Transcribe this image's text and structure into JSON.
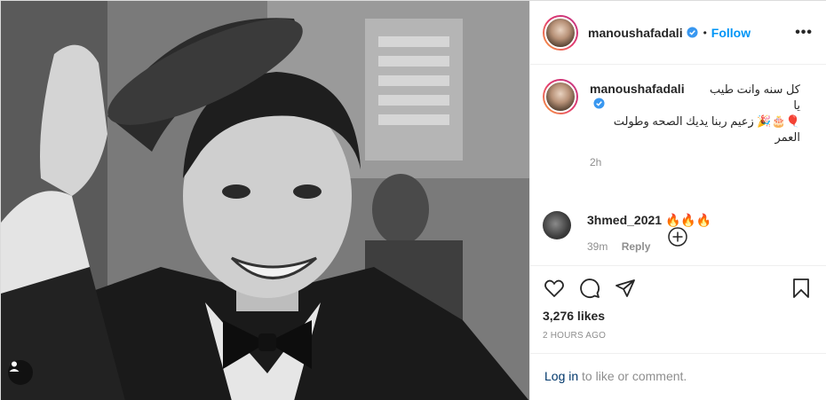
{
  "post": {
    "username": "manoushafadali",
    "follow_label": "Follow",
    "more_label": "•••",
    "caption_line1": "كل سنه وانت طيب يا",
    "caption_line2": "🎈🎂🎉 زعيم ربنا يديك الصحه وطولت العمر",
    "caption_time": "2h",
    "likes": "3,276 likes",
    "posted_ago": "2 HOURS AGO"
  },
  "comments": [
    {
      "username": "3hmed_2021",
      "text": "🔥🔥🔥",
      "time": "39m",
      "reply_label": "Reply"
    }
  ],
  "footer": {
    "login_link": "Log in",
    "login_rest": " to like or comment."
  },
  "icons": {
    "tag": "user-tag-icon",
    "verified": "verified-badge-icon",
    "load_more": "plus-circle-icon",
    "like": "heart-icon",
    "comment": "comment-bubble-icon",
    "share": "paper-plane-icon",
    "save": "bookmark-icon",
    "more": "ellipsis-icon"
  },
  "colors": {
    "accent": "#0095f6",
    "verified": "#3897f0",
    "text": "#262626",
    "muted": "#8e8e8e"
  }
}
